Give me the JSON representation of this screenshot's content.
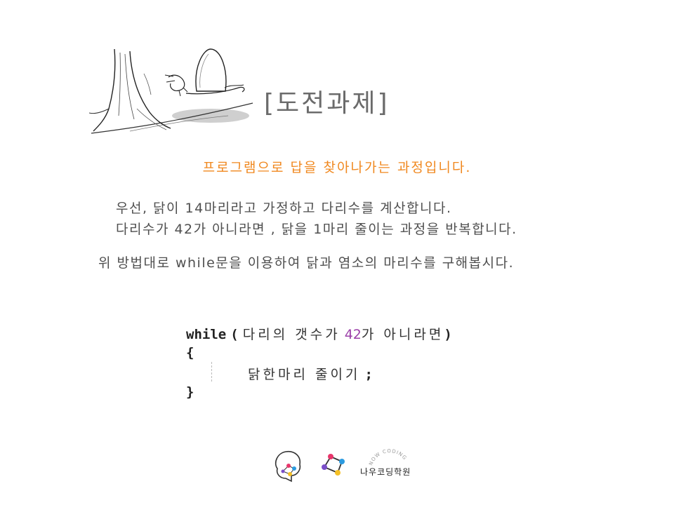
{
  "title": "[도전과제]",
  "subtitle": "프로그램으로 답을 찾아나가는 과정입니다.",
  "body": {
    "line1": "우선, 닭이 14마리라고 가정하고 다리수를 계산합니다.",
    "line2": "다리수가 42가 아니라면 , 닭을 1마리 줄이는 과정을 반복합니다.",
    "line3": "위 방법대로 while문을 이용하여 닭과 염소의 마리수를 구해봅시다."
  },
  "code": {
    "keyword": "while",
    "open_paren": "(",
    "cond_text_1": "다리의 갯수가",
    "cond_number": "42",
    "cond_text_2": "가 아니라면",
    "close_paren": ")",
    "open_brace": "{",
    "body_text": "닭한마리 줄이기",
    "semicolon": ";",
    "close_brace": "}"
  },
  "footer": {
    "academy_name": "나우코딩학원",
    "academy_arc_text": "NOW CODING"
  },
  "colors": {
    "subtitle": "#f0881f",
    "number": "#9b3fa8",
    "title": "#6b6b6b"
  }
}
